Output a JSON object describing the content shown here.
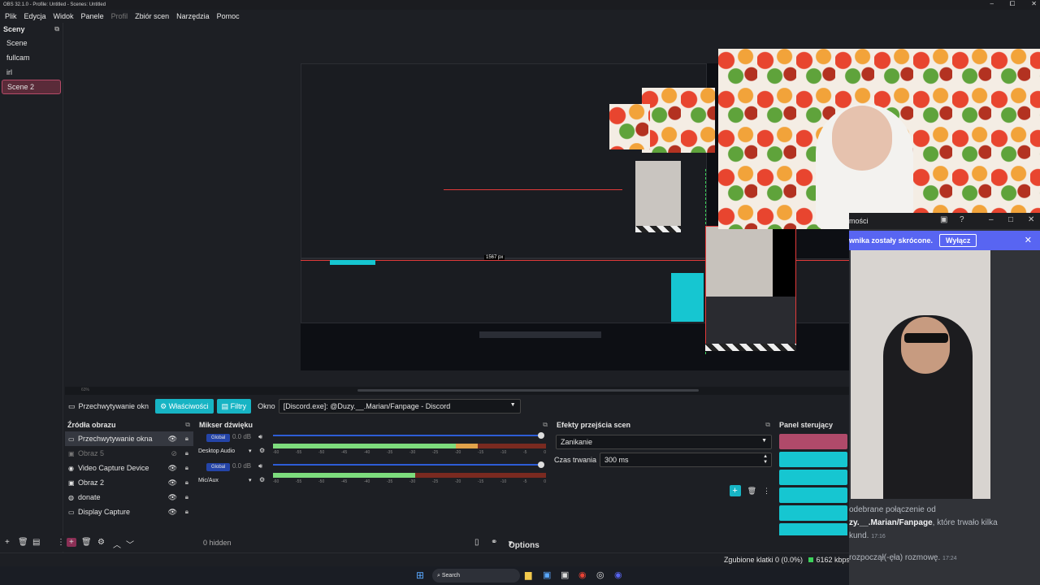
{
  "window": {
    "title": "OBS 32.1.0 - Profile: Untitled - Scenes: Untitled",
    "controls": [
      "–",
      "⧠",
      "✕"
    ]
  },
  "menu": {
    "items": [
      "Plik",
      "Edycja",
      "Widok",
      "Panele",
      "Profil",
      "Zbiór scen",
      "Narzędzia",
      "Pomoc"
    ]
  },
  "scenes": {
    "title": "Sceny",
    "items": [
      "Scene",
      "fullcam",
      "irl",
      "Scene 2"
    ],
    "active_index": 3
  },
  "preview": {
    "zoom_text": "63%",
    "nested_measure": "1567 px"
  },
  "source_toolbar": {
    "selected_source": "Przechwytywanie okn",
    "properties_label": "Właściwości",
    "filters_label": "Filtry",
    "window_label": "Okno",
    "window_value": "[Discord.exe]: @Duzy.__.Marian/Fanpage - Discord"
  },
  "sources": {
    "title": "Źródła obrazu",
    "items": [
      {
        "name": "Przechwytywanie okna",
        "icon": "window-icon",
        "selected": true,
        "visible": true
      },
      {
        "name": "Obraz 5",
        "icon": "image-icon",
        "selected": false,
        "visible": false
      },
      {
        "name": "Video Capture Device",
        "icon": "camera-icon",
        "selected": false,
        "visible": true
      },
      {
        "name": "Obraz 2",
        "icon": "image-icon",
        "selected": false,
        "visible": true
      },
      {
        "name": "donate",
        "icon": "globe-icon",
        "selected": false,
        "visible": true
      },
      {
        "name": "Display Capture",
        "icon": "monitor-icon",
        "selected": false,
        "visible": true
      }
    ]
  },
  "mixer": {
    "title": "Mikser dźwięku",
    "channels": [
      {
        "name": "Desktop Audio",
        "badge": "Global",
        "db": "0.0 dB",
        "level_green": 0.67,
        "level_yellow": 0.08
      },
      {
        "name": "Mic/Aux",
        "badge": "Global",
        "db": "0.0 dB",
        "level_green": 0.52,
        "level_yellow": 0.0
      }
    ],
    "ticks": [
      "-60",
      "-55",
      "-50",
      "-45",
      "-40",
      "-35",
      "-30",
      "-25",
      "-20",
      "-15",
      "-10",
      "-5",
      "0"
    ],
    "hidden_text": "0 hidden",
    "options_label": "Options"
  },
  "transitions": {
    "title": "Efekty przejścia scen",
    "selected": "Zanikanie",
    "duration_label": "Czas trwania",
    "duration_value": "300 ms"
  },
  "control": {
    "title": "Panel sterujący",
    "buttons": [
      {
        "color": "#b04a6a"
      },
      {
        "color": "#16c6d1"
      },
      {
        "color": "#16c6d1"
      },
      {
        "color": "#16c6d1"
      },
      {
        "color": "#16c6d1"
      },
      {
        "color": "#16c6d1"
      }
    ]
  },
  "status": {
    "dropped_frames": "Zgubione klatki 0 (0.0%)",
    "bitrate": "6162 kbps"
  },
  "taskbar": {
    "search": "Search"
  },
  "discord": {
    "window_title": "mości",
    "banner_text": "wnika zostały skrócone.",
    "banner_button": "Wyłącz",
    "messages": [
      {
        "text": "odebrane połączenie od"
      },
      {
        "bold": "zy.__.Marian/Fanpage",
        "text": ", które trwało kilka"
      },
      {
        "text": "kund.",
        "time": "17:16"
      },
      {
        "text": "rozpoczął(-ęła) rozmowę.",
        "time": "17:24"
      }
    ]
  }
}
